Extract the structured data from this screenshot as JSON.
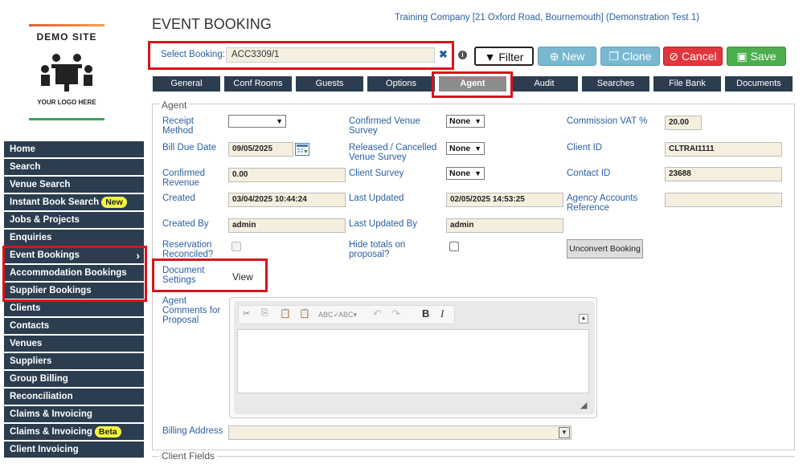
{
  "logo": {
    "top": "DEMO SITE",
    "bottom": "YOUR LOGO HERE"
  },
  "sidebar": {
    "items": [
      {
        "label": "Home"
      },
      {
        "label": "Search"
      },
      {
        "label": "Venue Search"
      },
      {
        "label": "Instant Book Search",
        "badge": "New"
      },
      {
        "label": "Jobs & Projects"
      },
      {
        "label": "Enquiries"
      },
      {
        "label": "Event Bookings",
        "chevron": "›"
      },
      {
        "label": "Accommodation Bookings"
      },
      {
        "label": "Supplier Bookings"
      },
      {
        "label": "Clients"
      },
      {
        "label": "Contacts"
      },
      {
        "label": "Venues"
      },
      {
        "label": "Suppliers"
      },
      {
        "label": "Group Billing"
      },
      {
        "label": "Reconciliation"
      },
      {
        "label": "Claims & Invoicing"
      },
      {
        "label": "Claims & Invoicing",
        "badge": "Beta"
      },
      {
        "label": "Client Invoicing"
      }
    ]
  },
  "header": {
    "title": "EVENT BOOKING",
    "company": "Training Company [21 Oxford Road, Bournemouth] (Demonstration Test 1)",
    "select_label": "Select Booking:",
    "select_value": "ACC3309/1",
    "clear": "✖",
    "info": "i"
  },
  "toolbar": {
    "filter": "Filter",
    "new": "New",
    "clone": "Clone",
    "cancel": "Cancel",
    "save": "Save"
  },
  "tabs": [
    "General",
    "Conf Rooms",
    "Guests",
    "Options",
    "Agent",
    "Audit",
    "Searches",
    "File Bank",
    "Documents"
  ],
  "agent": {
    "legend": "Agent",
    "receipt_method": {
      "label": "Receipt Method",
      "value": ""
    },
    "confirmed_venue_survey": {
      "label": "Confirmed Venue Survey",
      "value": "None"
    },
    "commission_vat": {
      "label": "Commission VAT %",
      "value": "20.00"
    },
    "bill_due_date": {
      "label": "Bill Due Date",
      "value": "09/05/2025"
    },
    "released_cancelled": {
      "label": "Released / Cancelled Venue Survey",
      "value": "None"
    },
    "client_id": {
      "label": "Client ID",
      "value": "CLTRAI1111"
    },
    "confirmed_revenue": {
      "label": "Confirmed Revenue",
      "value": "0.00"
    },
    "client_survey": {
      "label": "Client Survey",
      "value": "None"
    },
    "contact_id": {
      "label": "Contact ID",
      "value": "23688"
    },
    "created": {
      "label": "Created",
      "value": "03/04/2025 10:44:24"
    },
    "last_updated": {
      "label": "Last Updated",
      "value": "02/05/2025 14:53:25"
    },
    "agency_accounts_ref": {
      "label": "Agency Accounts Reference",
      "value": ""
    },
    "created_by": {
      "label": "Created By",
      "value": "admin"
    },
    "last_updated_by": {
      "label": "Last Updated By",
      "value": "admin"
    },
    "reservation_reconciled": {
      "label": "Reservation Reconciled?"
    },
    "hide_totals": {
      "label": "Hide totals on proposal?"
    },
    "unconvert": "Unconvert Booking",
    "document_settings": {
      "label": "Document Settings",
      "value": "View"
    },
    "agent_comments": {
      "label": "Agent Comments for Proposal"
    },
    "billing_address": {
      "label": "Billing Address",
      "value": ""
    }
  },
  "client_fields": {
    "legend": "Client Fields"
  },
  "colors": {
    "nav": "#2b3d4f",
    "accent_blue": "#2b5fa0",
    "highlight": "#d9141c"
  }
}
